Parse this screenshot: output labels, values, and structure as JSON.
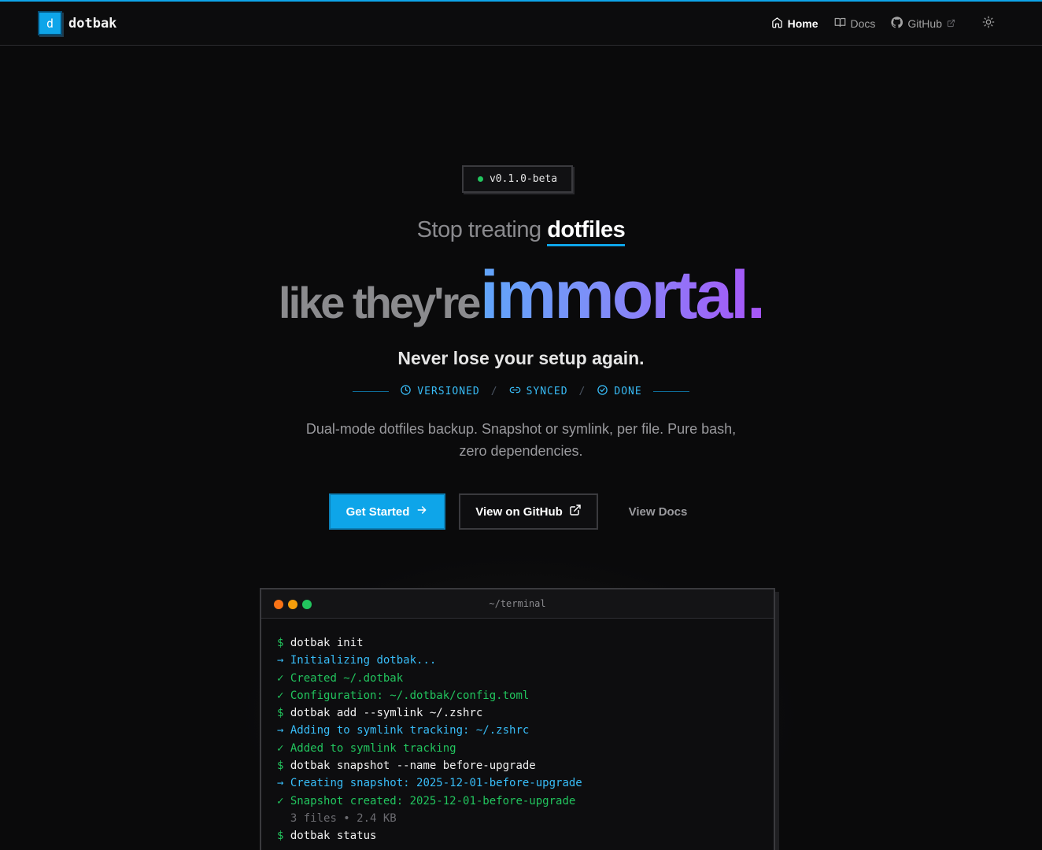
{
  "header": {
    "logo_letter": "d",
    "app_name": "dotbak",
    "nav": [
      {
        "label": "Home",
        "icon": "home-icon",
        "active": true
      },
      {
        "label": "Docs",
        "icon": "book-icon",
        "active": false
      },
      {
        "label": "GitHub",
        "icon": "github-icon",
        "active": false,
        "external": true
      }
    ],
    "theme_toggle_icon": "sun-icon"
  },
  "hero": {
    "version_badge": "v0.1.0-beta",
    "line1_prefix": "Stop treating",
    "line1_highlight": "dotfiles",
    "line2_prefix": "like they're",
    "line2_highlight": "immortal.",
    "subtitle": "Never lose your setup again.",
    "features": [
      {
        "label": "VERSIONED",
        "icon": "clock-icon"
      },
      {
        "label": "SYNCED",
        "icon": "link-icon"
      },
      {
        "label": "DONE",
        "icon": "check-circle-icon"
      }
    ],
    "separator": "/",
    "description": "Dual-mode dotfiles backup. Snapshot or symlink, per file. Pure bash, zero dependencies.",
    "buttons": {
      "get_started": "Get Started",
      "view_github": "View on GitHub",
      "view_docs": "View Docs"
    }
  },
  "terminal": {
    "title": "~/terminal",
    "lights": [
      "#f97316",
      "#f59e0b",
      "#22c55e"
    ],
    "lines": [
      {
        "kind": "cmd",
        "prefix": "$",
        "text": "dotbak init"
      },
      {
        "kind": "info",
        "prefix": "→",
        "text": "Initializing dotbak..."
      },
      {
        "kind": "ok",
        "prefix": "✓",
        "text": "Created ~/.dotbak"
      },
      {
        "kind": "ok",
        "prefix": "✓",
        "text": "Configuration: ~/.dotbak/config.toml"
      },
      {
        "kind": "cmd",
        "prefix": "$",
        "text": "dotbak add --symlink ~/.zshrc"
      },
      {
        "kind": "info",
        "prefix": "→",
        "text": "Adding to symlink tracking: ~/.zshrc"
      },
      {
        "kind": "ok",
        "prefix": "✓",
        "text": "Added to symlink tracking"
      },
      {
        "kind": "cmd",
        "prefix": "$",
        "text": "dotbak snapshot --name before-upgrade"
      },
      {
        "kind": "info",
        "prefix": "→",
        "text": "Creating snapshot: 2025-12-01-before-upgrade"
      },
      {
        "kind": "ok",
        "prefix": "✓",
        "text": "Snapshot created: 2025-12-01-before-upgrade"
      },
      {
        "kind": "meta",
        "prefix": " ",
        "text": "3 files • 2.4 KB"
      },
      {
        "kind": "cmd",
        "prefix": "$",
        "text": "dotbak status"
      }
    ]
  },
  "colors": {
    "accent": "#0ea5e9",
    "background": "#0a0a0b",
    "gradient_start": "#60a5fa",
    "gradient_end": "#a855f7",
    "success": "#22c55e"
  }
}
